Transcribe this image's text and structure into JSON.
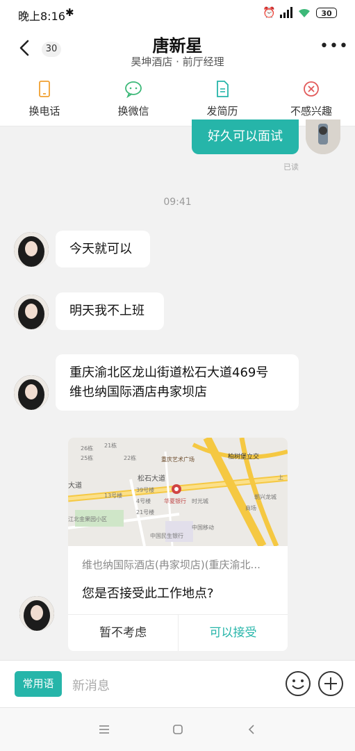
{
  "status": {
    "time": "晚上8:16",
    "battery": "30"
  },
  "header": {
    "badge": "30",
    "name": "唐新星",
    "subtitle": "昊坤酒店 · 前厅经理"
  },
  "actions": [
    {
      "label": "换电话",
      "icon": "phone-icon"
    },
    {
      "label": "换微信",
      "icon": "wechat-icon"
    },
    {
      "label": "发简历",
      "icon": "resume-icon"
    },
    {
      "label": "不感兴趣",
      "icon": "not-interested-icon"
    }
  ],
  "messages": {
    "sent_text": "好久可以面试",
    "read_status": "已读",
    "timestamp": "09:41",
    "recv1": "今天就可以",
    "recv2": "明天我不上班",
    "recv3_line1": "重庆渝北区龙山街道松石大道469号",
    "recv3_line2": "维也纳国际酒店冉家坝店"
  },
  "location_card": {
    "address": "维也纳国际酒店(冉家坝店)(重庆渝北...",
    "question": "您是否接受此工作地点?",
    "decline": "暂不考虑",
    "accept": "可以接受",
    "map_labels": [
      "26栋",
      "25栋",
      "21栋",
      "22栋",
      "重庆艺术广场",
      "柏树堡立交",
      "大道",
      "松石大道",
      "39号楼",
      "13号楼",
      "4号楼",
      "华夏银行",
      "时光城",
      "21号楼",
      "江北金果园小区",
      "中国移动",
      "中国民生银行",
      "朝兴龙城",
      "商场",
      "上"
    ]
  },
  "input": {
    "phrases_button": "常用语",
    "placeholder": "新消息"
  },
  "colors": {
    "accent": "#26b5a9",
    "orange": "#f0a030",
    "green": "#3cb878",
    "red": "#e25a5a"
  }
}
